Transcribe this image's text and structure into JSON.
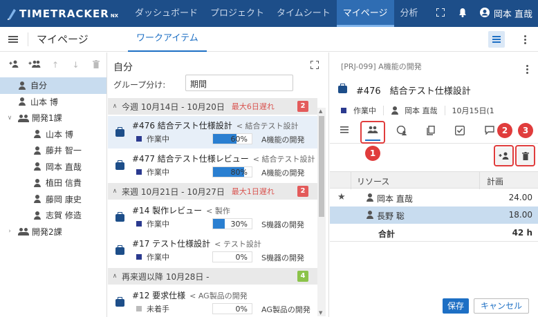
{
  "app": {
    "logo_text": "TIMETRACKER",
    "logo_suffix": "NX",
    "nav": [
      "ダッシュボード",
      "プロジェクト",
      "タイムシート",
      "マイページ",
      "分析"
    ],
    "active_nav": "マイページ",
    "user_name": "岡本 直哉",
    "accent": "#1d4e89"
  },
  "subheader": {
    "title": "マイページ",
    "tab": "ワークアイテム"
  },
  "tree": {
    "items": [
      {
        "label": "自分",
        "kind": "person",
        "level": 0,
        "selected": true
      },
      {
        "label": "山本 博",
        "kind": "person",
        "level": 0
      },
      {
        "label": "開発1課",
        "kind": "group",
        "level": 0,
        "expanded": true
      },
      {
        "label": "山本 博",
        "kind": "person",
        "level": 1
      },
      {
        "label": "藤井 智一",
        "kind": "person",
        "level": 1
      },
      {
        "label": "岡本 直哉",
        "kind": "person",
        "level": 1
      },
      {
        "label": "植田 信貴",
        "kind": "person",
        "level": 1
      },
      {
        "label": "藤岡 康史",
        "kind": "person",
        "level": 1
      },
      {
        "label": "志賀 修造",
        "kind": "person",
        "level": 1
      },
      {
        "label": "開発2課",
        "kind": "group",
        "level": 0,
        "expanded": false
      }
    ]
  },
  "middle": {
    "title": "自分",
    "groupby_label": "グループ分け:",
    "groupby_value": "期間",
    "groups": [
      {
        "label": "今週 10月14日 - 10月20日",
        "late": "最大6日遅れ",
        "count": "2",
        "badge": "red"
      },
      {
        "label": "来週 10月21日 - 10月27日",
        "late": "最大1日遅れ",
        "count": "2",
        "badge": "red"
      },
      {
        "label": "再来週以降 10月28日 -",
        "late": "",
        "count": "4",
        "badge": "green"
      }
    ],
    "items": [
      {
        "title": "#476 結合テスト仕様設計",
        "parent": "< 結合テスト設計",
        "status": "作業中",
        "status_color": "#2b3a8f",
        "progress": 60,
        "progress_text": "60%",
        "project": "A機能の開発",
        "selected": true
      },
      {
        "title": "#477 結合テスト仕様レビュー",
        "parent": "< 結合テスト設計",
        "status": "作業中",
        "status_color": "#2b3a8f",
        "progress": 80,
        "progress_text": "80%",
        "project": "A機能の開発"
      },
      {
        "title": "#14 製作レビュー",
        "parent": "< 製作",
        "status": "作業中",
        "status_color": "#2b3a8f",
        "progress": 30,
        "progress_text": "30%",
        "project": "S機器の開発"
      },
      {
        "title": "#17 テスト仕様設計",
        "parent": "< テスト設計",
        "status": "作業中",
        "status_color": "#2b3a8f",
        "progress": 0,
        "progress_text": "0%",
        "project": "S機器の開発"
      },
      {
        "title": "#12 要求仕様",
        "parent": "< AG製品の開発",
        "status": "未着手",
        "status_color": "#bbbbbb",
        "progress": 0,
        "progress_text": "0%",
        "project": "AG製品の開発"
      }
    ]
  },
  "detail": {
    "breadcrumb": "[PRJ-099] A機能の開発",
    "title": "#476　結合テスト仕様設計",
    "status": "作業中",
    "assignee": "岡本 直哉",
    "date": "10月15日(1",
    "annotations": [
      "1",
      "2",
      "3"
    ],
    "table": {
      "col_resource": "リソース",
      "col_plan": "計画",
      "rows": [
        {
          "name": "岡本 直哉",
          "value": "24.00",
          "star": true
        },
        {
          "name": "長野 聡",
          "value": "18.00",
          "selected": true
        }
      ],
      "total_label": "合計",
      "total_value": "42 h"
    },
    "save": "保存",
    "cancel": "キャンセル"
  }
}
